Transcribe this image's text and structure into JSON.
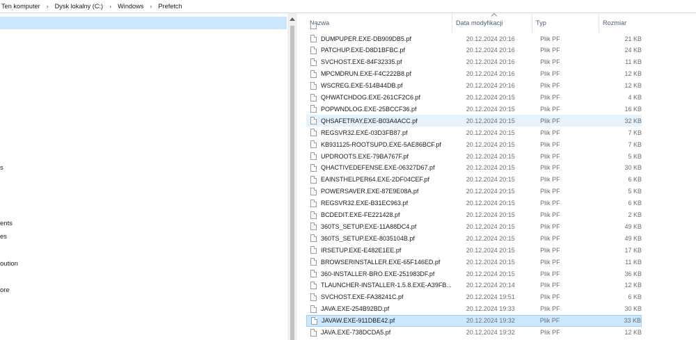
{
  "breadcrumb": [
    "Ten komputer",
    "Dysk lokalny (C:)",
    "Windows",
    "Prefetch"
  ],
  "nav_fragments": [
    "s",
    "ents",
    "es",
    "oution",
    "ore"
  ],
  "columns": {
    "name": "Nazwa",
    "date": "Data modyfikacji",
    "type": "Typ",
    "size": "Rozmiar"
  },
  "files": [
    {
      "name": "DUMPUPER.EXE-DB909DB5.pf",
      "date": "20.12.2024 20:16",
      "type": "Plik PF",
      "size": "21 KB"
    },
    {
      "name": "PATCHUP.EXE-D8D1BFBC.pf",
      "date": "20.12.2024 20:16",
      "type": "Plik PF",
      "size": "24 KB"
    },
    {
      "name": "SVCHOST.EXE-84F32335.pf",
      "date": "20.12.2024 20:16",
      "type": "Plik PF",
      "size": "11 KB"
    },
    {
      "name": "MPCMDRUN.EXE-F4C222B8.pf",
      "date": "20.12.2024 20:16",
      "type": "Plik PF",
      "size": "12 KB"
    },
    {
      "name": "WSCREG.EXE-514B44DB.pf",
      "date": "20.12.2024 20:16",
      "type": "Plik PF",
      "size": "12 KB"
    },
    {
      "name": "QHWATCHDOG.EXE-261CF2C6.pf",
      "date": "20.12.2024 20:15",
      "type": "Plik PF",
      "size": "4 KB"
    },
    {
      "name": "POPWNDLOG.EXE-25BCCF36.pf",
      "date": "20.12.2024 20:15",
      "type": "Plik PF",
      "size": "16 KB"
    },
    {
      "name": "QHSAFETRAY.EXE-B03A4ACC.pf",
      "date": "20.12.2024 20:15",
      "type": "Plik PF",
      "size": "32 KB"
    },
    {
      "name": "REGSVR32.EXE-03D3FB87.pf",
      "date": "20.12.2024 20:15",
      "type": "Plik PF",
      "size": "7 KB"
    },
    {
      "name": "KB931125-ROOTSUPD.EXE-5AE86BCF.pf",
      "date": "20.12.2024 20:15",
      "type": "Plik PF",
      "size": "7 KB"
    },
    {
      "name": "UPDROOTS.EXE-79BA767F.pf",
      "date": "20.12.2024 20:15",
      "type": "Plik PF",
      "size": "5 KB"
    },
    {
      "name": "QHACTIVEDEFENSE.EXE-06327D67.pf",
      "date": "20.12.2024 20:15",
      "type": "Plik PF",
      "size": "30 KB"
    },
    {
      "name": "EAINSTHELPER64.EXE-2DF04CEF.pf",
      "date": "20.12.2024 20:15",
      "type": "Plik PF",
      "size": "6 KB"
    },
    {
      "name": "POWERSAVER.EXE-87E9E08A.pf",
      "date": "20.12.2024 20:15",
      "type": "Plik PF",
      "size": "5 KB"
    },
    {
      "name": "REGSVR32.EXE-B31EC963.pf",
      "date": "20.12.2024 20:15",
      "type": "Plik PF",
      "size": "6 KB"
    },
    {
      "name": "BCDEDIT.EXE-FE221428.pf",
      "date": "20.12.2024 20:15",
      "type": "Plik PF",
      "size": "2 KB"
    },
    {
      "name": "360TS_SETUP.EXE-11A88DC4.pf",
      "date": "20.12.2024 20:15",
      "type": "Plik PF",
      "size": "49 KB"
    },
    {
      "name": "360TS_SETUP.EXE-8035104B.pf",
      "date": "20.12.2024 20:15",
      "type": "Plik PF",
      "size": "49 KB"
    },
    {
      "name": "IRSETUP.EXE-E482E1EE.pf",
      "date": "20.12.2024 20:15",
      "type": "Plik PF",
      "size": "17 KB"
    },
    {
      "name": "BROWSERINSTALLER.EXE-65F146ED.pf",
      "date": "20.12.2024 20:15",
      "type": "Plik PF",
      "size": "11 KB"
    },
    {
      "name": "360-INSTALLER-BRO.EXE-251983DF.pf",
      "date": "20.12.2024 20:15",
      "type": "Plik PF",
      "size": "36 KB"
    },
    {
      "name": "TLAUNCHER-INSTALLER-1.5.8.EXE-A39FB...",
      "date": "20.12.2024 20:14",
      "type": "Plik PF",
      "size": "12 KB"
    },
    {
      "name": "SVCHOST.EXE-FA38241C.pf",
      "date": "20.12.2024 19:51",
      "type": "Plik PF",
      "size": "6 KB"
    },
    {
      "name": "JAVA.EXE-254B92BD.pf",
      "date": "20.12.2024 19:33",
      "type": "Plik PF",
      "size": "30 KB"
    },
    {
      "name": "JAVAW.EXE-911DBE42.pf",
      "date": "20.12.2024 19:32",
      "type": "Plik PF",
      "size": "33 KB"
    },
    {
      "name": "JAVA.EXE-738DCDA5.pf",
      "date": "20.12.2024 19:32",
      "type": "Plik PF",
      "size": "12 KB"
    }
  ],
  "hovered_index": 7,
  "selected_index": 24,
  "colors": {
    "selected_bg": "#cce8ff",
    "hover_bg": "#e5f3ff",
    "header_text": "#4c607a"
  }
}
